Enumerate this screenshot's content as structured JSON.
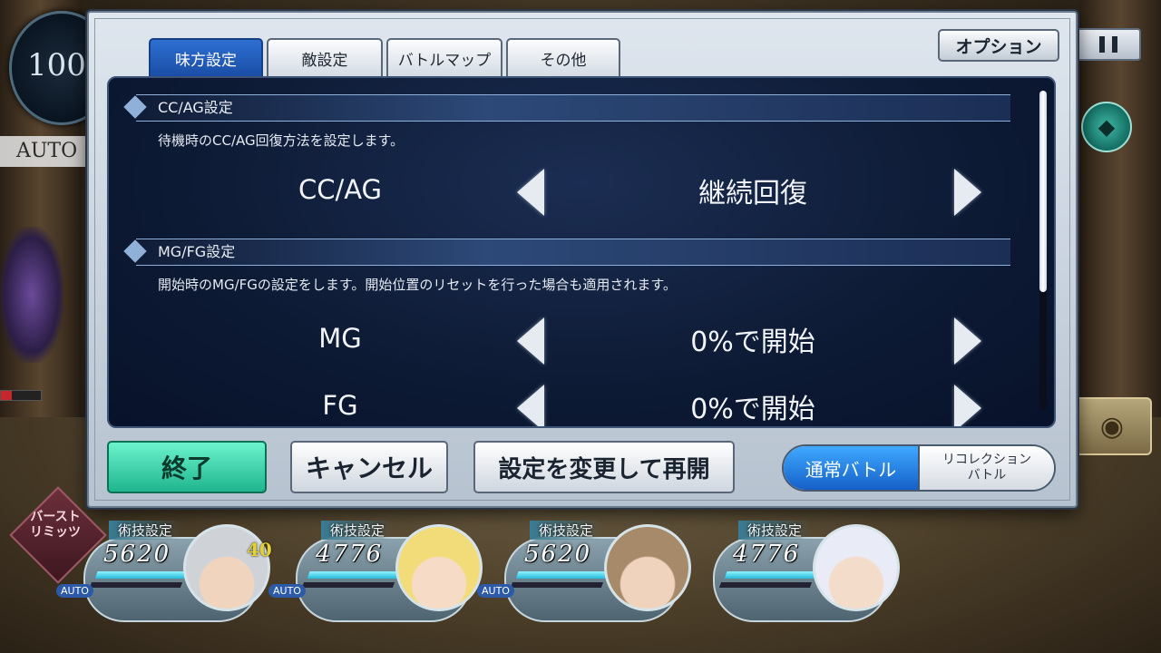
{
  "level": "100",
  "auto_toggle": "AUTO",
  "tabs": [
    {
      "label": "味方設定",
      "active": true
    },
    {
      "label": "敵設定",
      "active": false
    },
    {
      "label": "バトルマップ",
      "active": false
    },
    {
      "label": "その他",
      "active": false
    }
  ],
  "option_label": "オプション",
  "sections": [
    {
      "title": "CC/AG設定",
      "description": "待機時のCC/AG回復方法を設定します。",
      "settings": [
        {
          "label": "CC/AG",
          "value": "継続回復"
        }
      ]
    },
    {
      "title": "MG/FG設定",
      "description": "開始時のMG/FGの設定をします。開始位置のリセットを行った場合も適用されます。",
      "settings": [
        {
          "label": "MG",
          "value": "0%で開始"
        },
        {
          "label": "FG",
          "value": "0%で開始"
        }
      ]
    }
  ],
  "buttons": {
    "end": "終了",
    "cancel": "キャンセル",
    "resume": "設定を変更して再開"
  },
  "mode": {
    "normal": "通常バトル",
    "recollection_line1": "リコレクション",
    "recollection_line2": "バトル",
    "selected": "通常バトル"
  },
  "burst_limit": {
    "line1": "バースト",
    "line2": "リミッツ"
  },
  "characters": [
    {
      "skill_label": "術技設定",
      "hp": "5620",
      "tp": "40",
      "auto": "AUTO",
      "hp_fill": 0.85,
      "hair": "#cfd3d8",
      "skin": "#f1d4bd"
    },
    {
      "skill_label": "術技設定",
      "hp": "4776",
      "tp": "",
      "auto": "AUTO",
      "hp_fill": 0.85,
      "hair": "#f2dc7a",
      "skin": "#f6dcc6"
    },
    {
      "skill_label": "術技設定",
      "hp": "5620",
      "tp": "",
      "auto": "AUTO",
      "hp_fill": 0.85,
      "hair": "#a78a6a",
      "skin": "#f0d3bd"
    },
    {
      "skill_label": "術技設定",
      "hp": "4776",
      "tp": "",
      "auto": "",
      "hp_fill": 0.85,
      "hair": "#e9ecf6",
      "skin": "#f4dccb"
    }
  ]
}
